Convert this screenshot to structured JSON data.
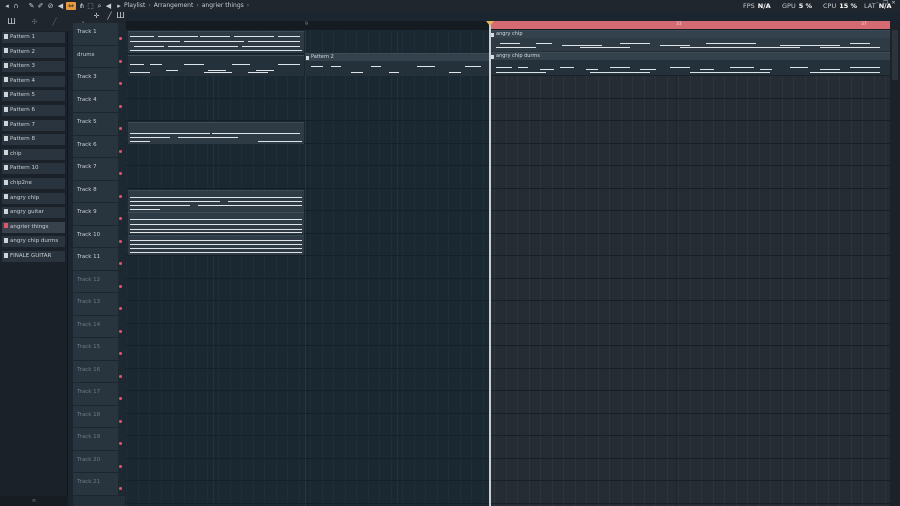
{
  "titlebar": {
    "crumbs": [
      "Playlist",
      "Arrangement",
      "angrier things"
    ],
    "separator": "›"
  },
  "stats": {
    "fps_label": "FPS",
    "fps_value": "N/A",
    "gpu_label": "GPU",
    "gpu_value": "5 %",
    "cpu_label": "CPU",
    "cpu_value": "15 %",
    "lat_label": "LAT",
    "lat_value": "N/A"
  },
  "window_buttons": [
    "–",
    "❐",
    "✕"
  ],
  "patterns": [
    "Pattern 1",
    "Pattern 2",
    "Pattern 3",
    "Pattern 4",
    "Pattern 5",
    "Pattern 6",
    "Pattern 7",
    "Pattern 8",
    "chip",
    "Pattern 10",
    "chip2ne",
    "angry chip",
    "angry guitar",
    "angrier things",
    "angry chip durms",
    "FINALE GUITAR"
  ],
  "selected_pattern_index": 13,
  "tracks": [
    "Track 1",
    "drums",
    "Track 3",
    "Track 4",
    "Track 5",
    "Track 6",
    "Track 7",
    "Track 8",
    "Track 9",
    "Track 10",
    "Track 11",
    "Track 12",
    "Track 13",
    "Track 14",
    "Track 15",
    "Track 16",
    "Track 17",
    "Track 18",
    "Track 19",
    "Track 20",
    "Track 21"
  ],
  "ruler": {
    "marks": [
      "9",
      "17"
    ],
    "loop_mark": "33",
    "loop_end_mark": "37"
  },
  "clips": {
    "pattern2_label": "Pattern 2",
    "angry_chip_label": "angry chip",
    "angry_chip_durms_label": "angry chip durms"
  },
  "colors": {
    "accent": "#d46a72",
    "mute_dot": "#e0576b",
    "background": "#1a2832"
  }
}
